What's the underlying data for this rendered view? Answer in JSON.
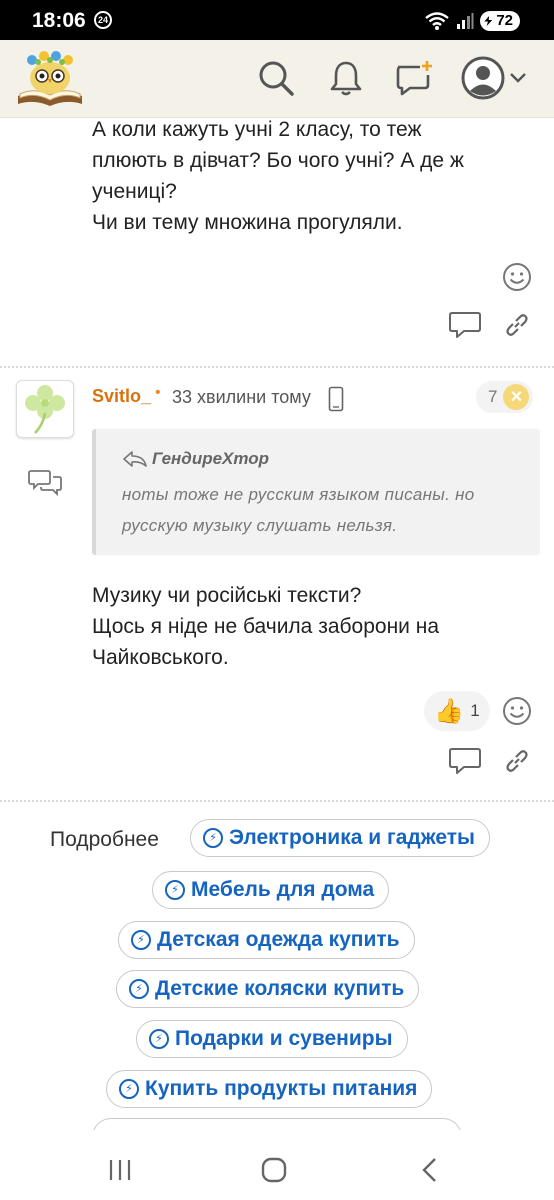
{
  "status_bar": {
    "time": "18:06",
    "notification_badge": "24",
    "battery": "72"
  },
  "header": {
    "logo": "owl-books-logo",
    "icons": [
      "search-icon",
      "bell-icon",
      "new-message-icon",
      "profile-icon"
    ]
  },
  "comment_top": {
    "lines": [
      "А коли кажуть учні 2 класу, то теж",
      "плюють в дівчат? Бо чого учні? А де ж",
      "учениці?",
      "Чи ви тему множина прогуляли."
    ]
  },
  "comment_second": {
    "username": "Svitlo_",
    "online_marker": "•",
    "time_ago": "33 хвилини тому",
    "rating": "7",
    "rating_icon": "×",
    "quote": {
      "author": "ГендиреХтор",
      "text": "ноты тоже не русским языком писаны. но русскую музыку слушать нельзя."
    },
    "lines": [
      "Музику чи російські тексти?",
      "Щось я ніде не бачила заборони на",
      "Чайковського."
    ],
    "likes": "1",
    "like_emoji": "👍"
  },
  "more": {
    "label": "Подробнее",
    "tags": [
      "Электроника и гаджеты",
      "Мебель для дома",
      "Детская одежда купить",
      "Детские коляски купить",
      "Подарки и сувениры",
      "Купить продукты питания"
    ]
  },
  "colors": {
    "username": "#d9720b",
    "tag_text": "#1565c0",
    "header_bg": "#f4f1e8"
  }
}
